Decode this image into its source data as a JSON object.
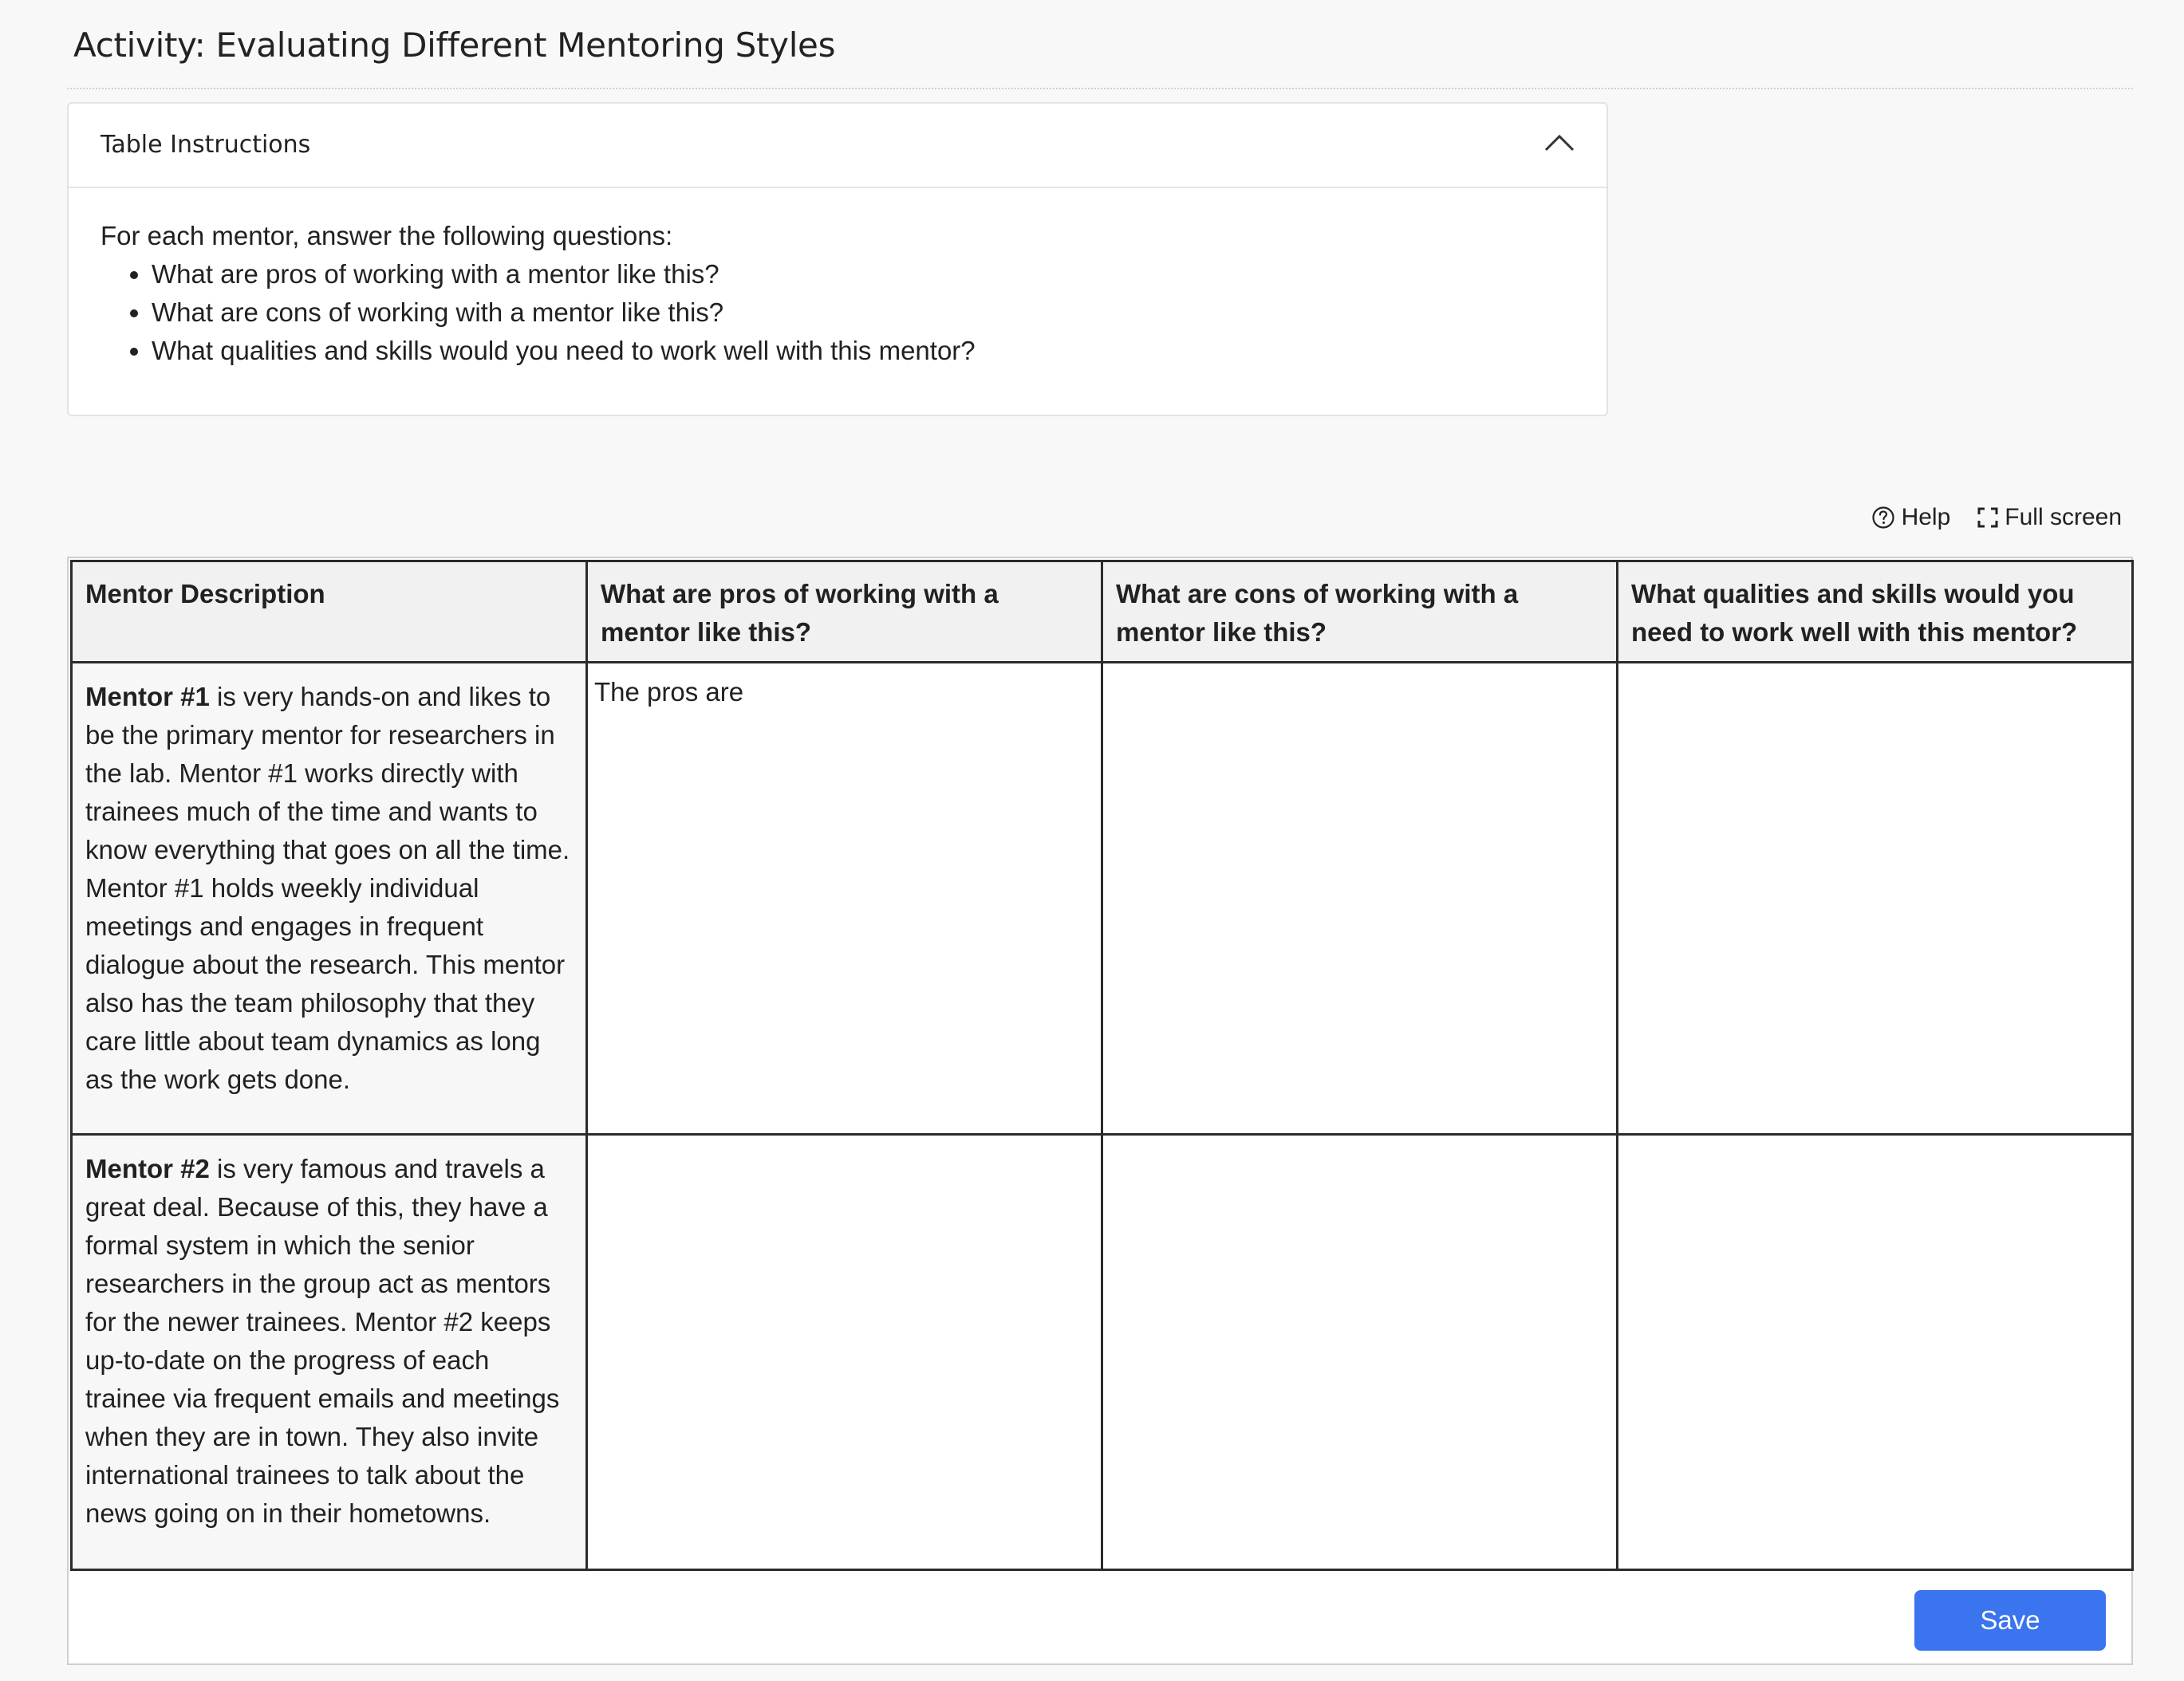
{
  "page": {
    "title": "Activity: Evaluating Different Mentoring Styles"
  },
  "instructions": {
    "header": "Table Instructions",
    "intro": "For each mentor, answer the following questions:",
    "items": [
      "What are pros of working with a mentor like this?",
      "What are cons of working with a mentor like this?",
      "What qualities and skills would you need to work well with this mentor?"
    ]
  },
  "toolbar": {
    "help_label": "Help",
    "fullscreen_label": "Full screen"
  },
  "table": {
    "headers": [
      "Mentor Description",
      "What are pros of working with a mentor like this?",
      "What are cons of working with a mentor like this?",
      "What qualities and skills would you need to work well with this mentor?"
    ],
    "rows": [
      {
        "mentor_name": "Mentor #1",
        "mentor_text": " is very hands-on and likes to be the primary mentor for researchers in the lab. Mentor #1 works directly with trainees much of the time and wants to know everything that goes on all the time. Mentor #1 holds weekly individual meetings and engages in frequent dialogue about the research. This mentor also has the team philosophy that they care little about team dynamics as long as the work gets done.",
        "pros": "The pros are",
        "cons": "",
        "qualities": ""
      },
      {
        "mentor_name": "Mentor #2",
        "mentor_text": " is very famous and travels a great deal. Because of this, they have a formal system in which the senior researchers in the group act as mentors for the newer trainees. Mentor #2 keeps up-to-date on the progress of each trainee via frequent emails and meetings when they are in town. They also invite international trainees to talk about the news going on in their hometowns.",
        "pros": "",
        "cons": "",
        "qualities": ""
      }
    ]
  },
  "actions": {
    "save_label": "Save"
  },
  "colors": {
    "save_button": "#3a74ee",
    "header_bg": "#f1f1f1",
    "page_bg": "#f8f8f8"
  }
}
